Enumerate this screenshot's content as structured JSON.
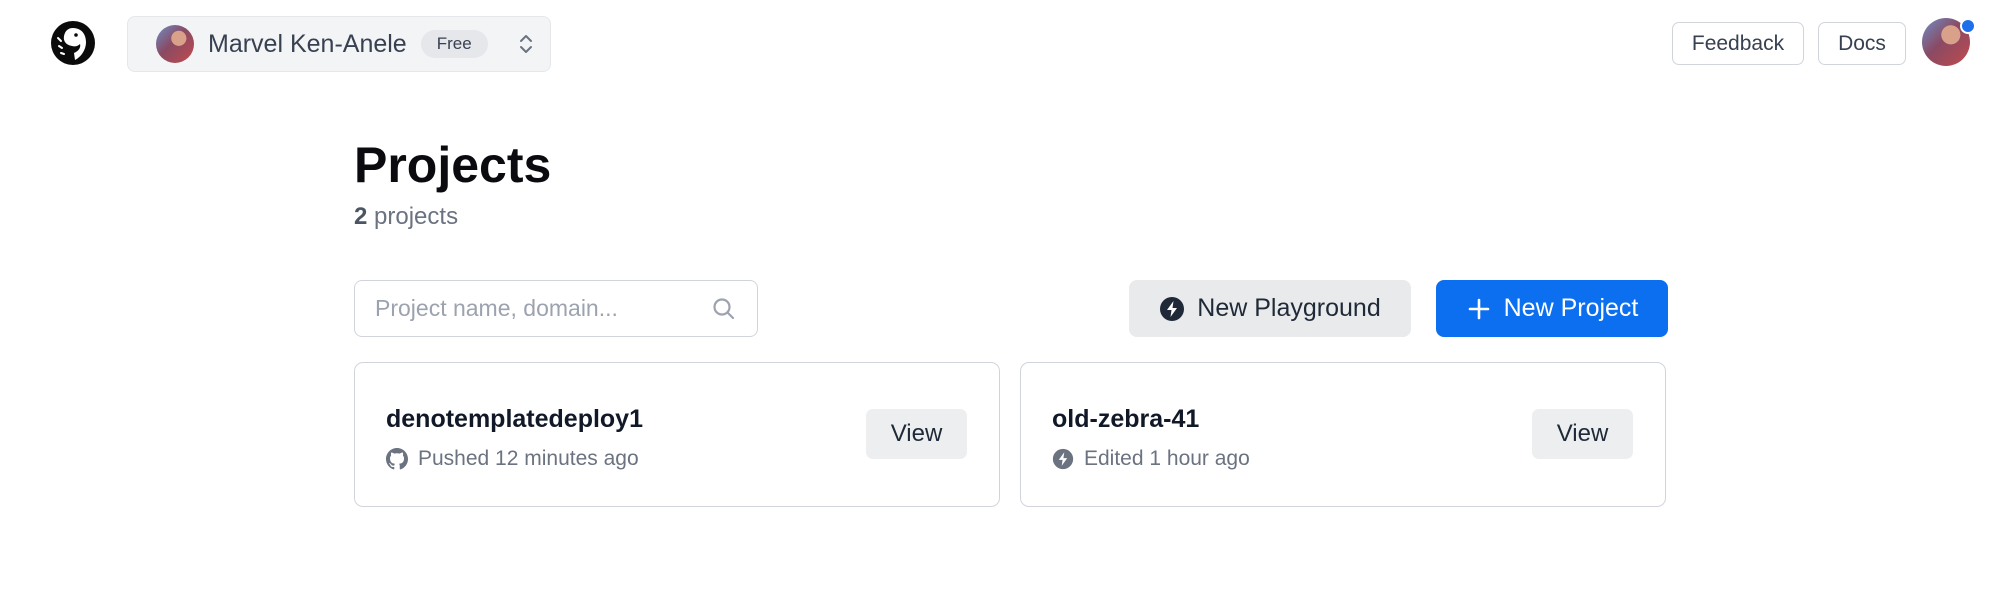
{
  "header": {
    "logo_icon": "deno-dinosaur-logo",
    "org": {
      "name": "Marvel Ken-Anele",
      "plan": "Free",
      "switch_icon": "chevron-updown-icon"
    },
    "feedback_label": "Feedback",
    "docs_label": "Docs",
    "notification_color": "#1f6feb"
  },
  "main": {
    "title": "Projects",
    "count_number": "2",
    "count_suffix": " projects",
    "search": {
      "placeholder": "Project name, domain...",
      "value": ""
    },
    "new_playground_label": "New Playground",
    "new_project_label": "New Project",
    "accent_color": "#0b6ff0"
  },
  "projects": [
    {
      "name": "denotemplatedeploy1",
      "source_icon": "github-icon",
      "status": "Pushed 12 minutes ago",
      "view_label": "View"
    },
    {
      "name": "old-zebra-41",
      "source_icon": "bolt-icon",
      "status": "Edited 1 hour ago",
      "view_label": "View"
    }
  ]
}
